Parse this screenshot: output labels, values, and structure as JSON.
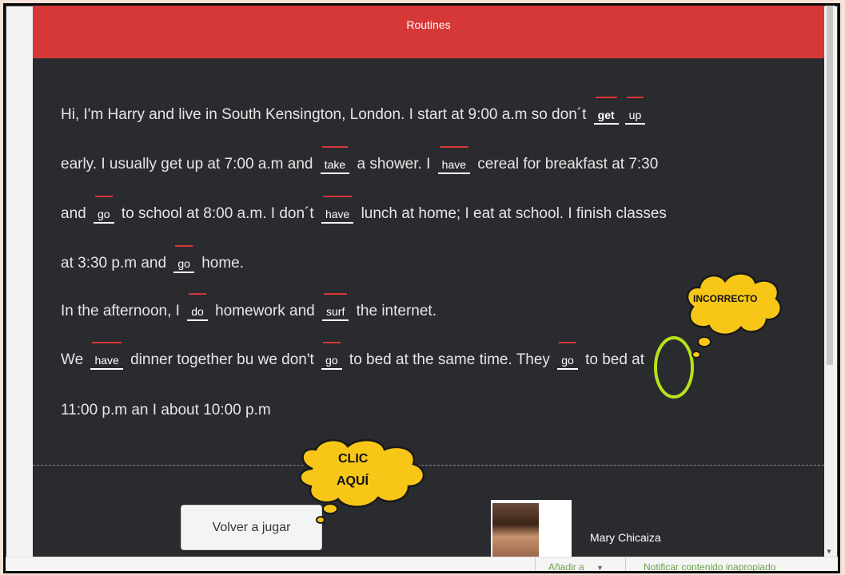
{
  "title": "Routines",
  "story": {
    "l1_a": "Hi, I'm Harry and live in South Kensington, London. I start at 9:00 a.m so don´t",
    "b_get": "get",
    "b_up": "up",
    "l2_a": "early. I usually get up at 7:00 a.m and",
    "b_take": "take",
    "l2_b": "a shower. I",
    "b_have1": "have",
    "l2_c": "cereal for breakfast at 7:30",
    "l3_a": "and",
    "b_go1": "go",
    "l3_b": "to school at 8:00 a.m. I don´t",
    "b_have2": "have",
    "l3_c": "lunch at home; I eat at school. I finish classes",
    "l4_a": "at 3:30 p.m and",
    "b_go2": "go",
    "l4_b": "home.",
    "l5_a": "In the afternoon, I",
    "b_do": "do",
    "l5_b": "homework and",
    "b_surf": "surf",
    "l5_c": "the internet.",
    "l6_a": "We",
    "b_have3": "have",
    "l6_b": "dinner together bu we don't",
    "b_go3": "go",
    "l6_c": "to bed at the same time. They",
    "b_go4": "go",
    "l6_d": "to bed at",
    "l7_a": "11:00 p.m an I about 10:00 p.m"
  },
  "callouts": {
    "incorrect": "INCORRECTO",
    "click_line1": "CLIC",
    "click_line2": "AQUÍ"
  },
  "retry_label": "Volver a jugar",
  "author_name": "Mary Chicaiza",
  "footer": {
    "add_to": "Añadir a",
    "add_to_arrow": "▼",
    "report": "Notificar contenido inapropiado"
  },
  "colors": {
    "title_bar": "#d63737",
    "panel": "#2a2b2f",
    "callout": "#f7c617",
    "marker": "#b5e21a"
  }
}
